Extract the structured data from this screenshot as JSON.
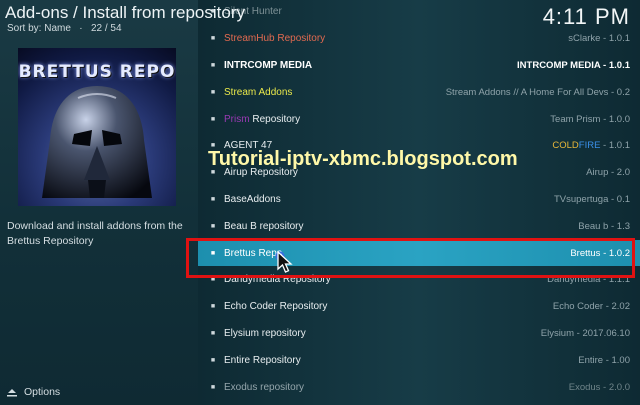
{
  "header": {
    "title": "Add-ons / Install from repository",
    "sort_label": "Sort by: Name",
    "position": "22 / 54",
    "clock": "4:11 PM"
  },
  "addon": {
    "thumbnail_title": "BRETTUS REPO",
    "description": "Download and install addons from the Brettus Repository"
  },
  "footer": {
    "options_label": "Options"
  },
  "watermark": "Tutorial-iptv-xbmc.blogspot.com",
  "list": [
    {
      "name": "Silent Hunter",
      "meta": "",
      "name_color": "#7f9297",
      "dim": true
    },
    {
      "name": "StreamHub Repository",
      "meta": "sClarke - 1.0.1",
      "name_color": "#e26a50"
    },
    {
      "name": "INTRCOMP MEDIA",
      "meta": "INTRCOMP MEDIA - 1.0.1",
      "name_color": "#ffffff",
      "meta_color": "#ffffff",
      "bold": true
    },
    {
      "name": "Stream Addons",
      "meta": "Stream Addons // A Home For All Devs - 0.2",
      "name_color": "#e9e84a"
    },
    {
      "name": "Repository",
      "prefix": "Prism",
      "prefix_color": "#9a3ab3",
      "meta": "Team Prism - 1.0.0",
      "name_color": "#e8eef0"
    },
    {
      "name": "AGENT 47",
      "meta_parts": [
        "COLD",
        "FIRE",
        " - 1.0.1"
      ],
      "meta_colors": [
        "#e8b73a",
        "#3a8fe8",
        "#8fa3aa"
      ]
    },
    {
      "name": "Airup Repository",
      "meta": "Airup - 2.0"
    },
    {
      "name": "BaseAddons",
      "meta": "TVsupertuga - 0.1"
    },
    {
      "name": "Beau B repository",
      "meta": "Beau b - 1.3"
    },
    {
      "name": "Brettus Repo",
      "meta": "Brettus - 1.0.2",
      "focused": true
    },
    {
      "name": "Dandymedia Repository",
      "meta": "Dandymedia - 1.1.1"
    },
    {
      "name": "Echo Coder Repository",
      "meta": "Echo Coder - 2.02"
    },
    {
      "name": "Elysium repository",
      "meta": "Elysium - 2017.06.10"
    },
    {
      "name": "Entire Repository",
      "meta": "Entire - 1.00"
    },
    {
      "name": "Exodus repository",
      "meta": "Exodus - 2.0.0",
      "dim": true
    }
  ],
  "colors": {
    "focus_bar": "#2aa3c3",
    "annotation_box": "#e01212",
    "watermark": "#fff8a8"
  }
}
